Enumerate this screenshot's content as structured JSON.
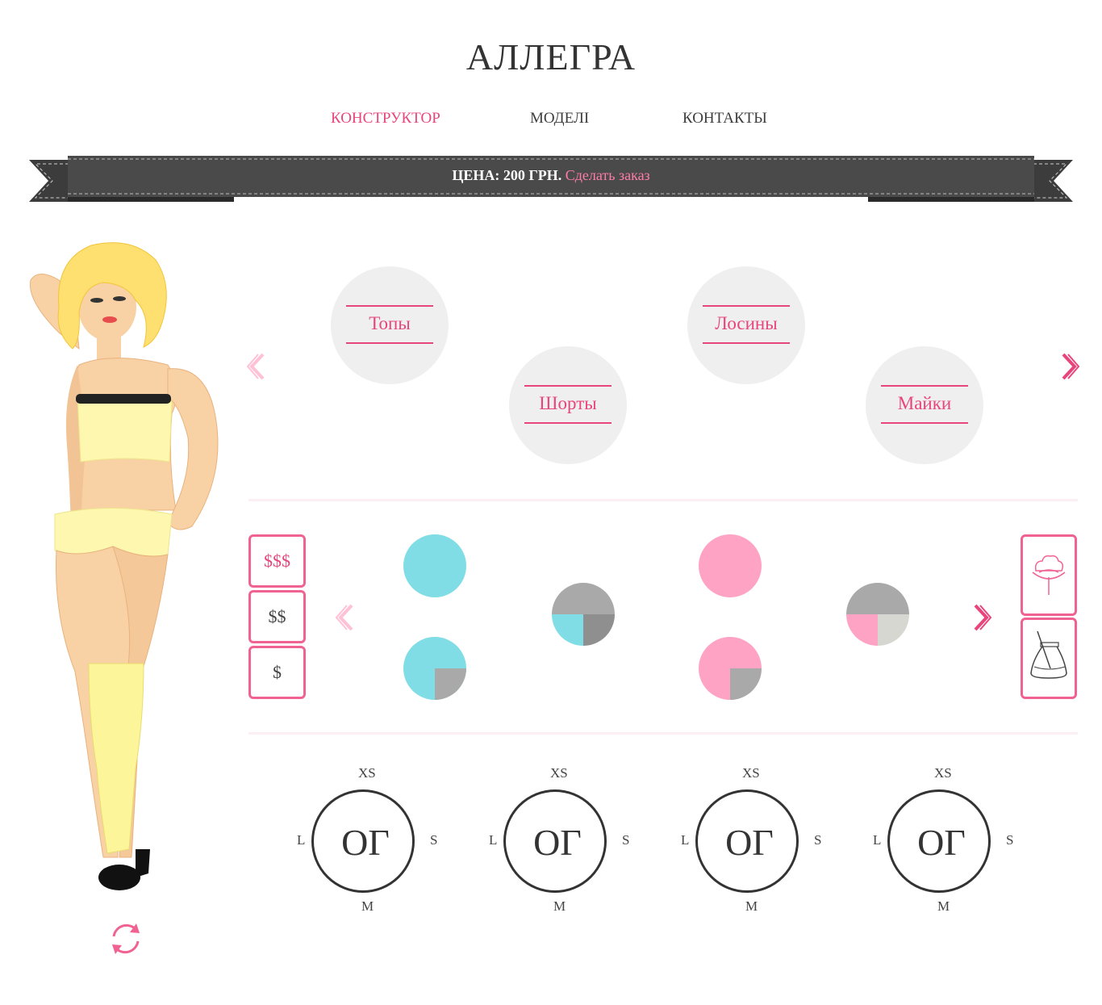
{
  "header": {
    "logo": "АЛЛЕГРА"
  },
  "nav": {
    "items": [
      {
        "label": "КОНСТРУКТОР",
        "active": true
      },
      {
        "label": "МОДЕЛІ",
        "active": false
      },
      {
        "label": "КОНТАКТЫ",
        "active": false
      }
    ]
  },
  "banner": {
    "price_text": "ЦЕНА: 200 ГРН.",
    "order_link": "Сделать заказ"
  },
  "categories": [
    {
      "label": "Топы"
    },
    {
      "label": "Шорты"
    },
    {
      "label": "Лосины"
    },
    {
      "label": "Майки"
    }
  ],
  "price_filter": {
    "items": [
      "$$$",
      "$$",
      "$"
    ],
    "active": "$$$"
  },
  "materials": {
    "icons": [
      "cotton-flower-icon",
      "fabric-pot-icon"
    ]
  },
  "swatches": {
    "colors": {
      "cyan": "#80dde6",
      "gray": "#a9a9a9",
      "dark_gray": "#8f8f8f",
      "pink": "#ffa3c5",
      "light_gray": "#d7d7d1"
    }
  },
  "sizes": {
    "dials": [
      {
        "center": "ОГ",
        "top": "XS",
        "right": "S",
        "bottom": "M",
        "left": "L"
      },
      {
        "center": "ОГ",
        "top": "XS",
        "right": "S",
        "bottom": "M",
        "left": "L"
      },
      {
        "center": "ОГ",
        "top": "XS",
        "right": "S",
        "bottom": "M",
        "left": "L"
      },
      {
        "center": "ОГ",
        "top": "XS",
        "right": "S",
        "bottom": "M",
        "left": "L"
      }
    ]
  },
  "model": {
    "reset_icon": "rotate-reset-icon"
  },
  "colors": {
    "accent": "#e8457c",
    "banner": "#4a4a4a",
    "circle_bg": "#efefef"
  }
}
